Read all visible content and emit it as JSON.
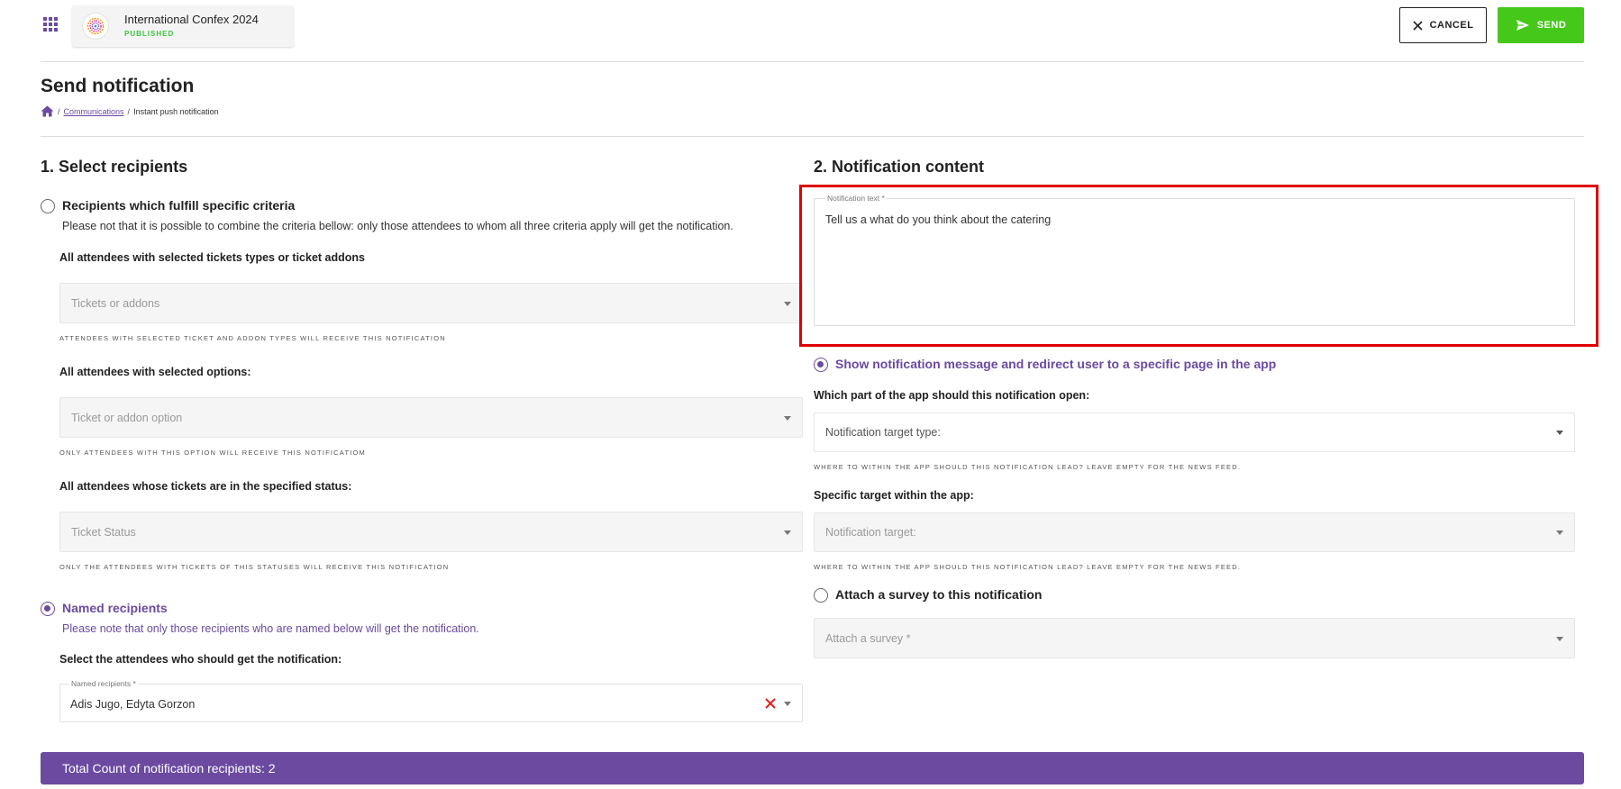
{
  "header": {
    "event_name": "International Confex 2024",
    "event_status": "PUBLISHED",
    "cancel_label": "CANCEL",
    "send_label": "SEND"
  },
  "page": {
    "title": "Send notification",
    "breadcrumb": {
      "separator": "/",
      "link": "Communications",
      "current": "Instant push notification"
    }
  },
  "recipients": {
    "section_title": "1. Select recipients",
    "criteria_option": {
      "label": "Recipients which fulfill specific criteria",
      "description": "Please not that it is possible to combine the criteria bellow: only those attendees to whom all three criteria apply will get the notification.",
      "selected": false
    },
    "tickets": {
      "label": "All attendees with selected tickets types or ticket addons",
      "placeholder": "Tickets or addons",
      "hint": "Attendees with selected ticket and addon types will receive this notification"
    },
    "options": {
      "label": "All attendees with selected options:",
      "placeholder": "Ticket or addon option",
      "hint": "Only attendees with this option will receive this notificatiom"
    },
    "status": {
      "label": "All attendees whose tickets are in the specified status:",
      "placeholder": "Ticket Status",
      "hint": "Only the attendees with tickets of this statuses will receive this notification"
    },
    "named_option": {
      "label": "Named recipients",
      "description": "Please note that only those recipients who are named below will get the notification.",
      "selected": true
    },
    "named_select": {
      "label": "Select the attendees who should get the notification:",
      "float_label": "Named recipients *",
      "value": "Adis Jugo, Edyta Gorzon"
    }
  },
  "content": {
    "section_title": "2. Notification content",
    "notification_text": {
      "float_label": "Notification text *",
      "value": "Tell us a what do you think about the catering"
    },
    "redirect_option": {
      "label": "Show notification message and redirect user to a specific page in the app",
      "selected": true
    },
    "target_type": {
      "label": "Which part of the app should this notification open:",
      "placeholder": "Notification target type:",
      "hint": "Where to within the app should this notification lead? Leave empty for the news feed."
    },
    "target": {
      "label": "Specific target within the app:",
      "placeholder": "Notification target:",
      "hint": "Where to within the app should this notification lead? Leave empty for the news feed."
    },
    "survey_option": {
      "label": "Attach a survey to this notification",
      "selected": false
    },
    "survey_select": {
      "placeholder": "Attach a survey *"
    }
  },
  "footer": {
    "total_count": "Total Count of notification recipients: 2"
  },
  "colors": {
    "accent": "#6b4aa0",
    "send": "#45c81a",
    "highlight": "#e00000",
    "status_published": "#3cc43c"
  }
}
